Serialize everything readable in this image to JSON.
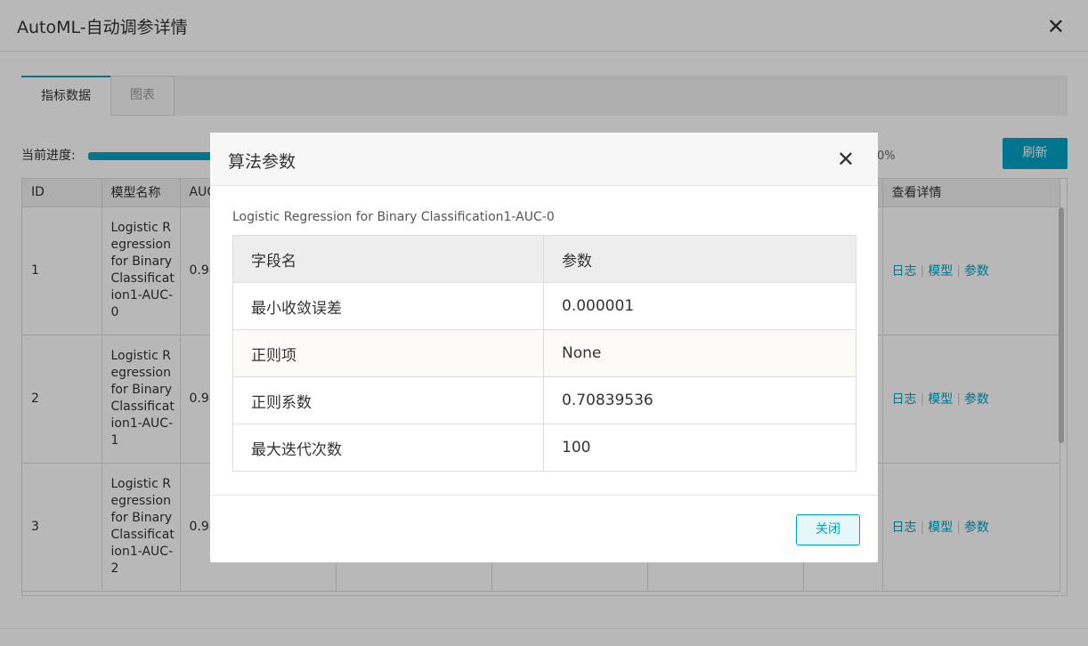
{
  "panel": {
    "title": "AutoML-自动调参详情",
    "close_icon": "✕",
    "tabs": [
      {
        "label": "指标数据",
        "active": true
      },
      {
        "label": "图表",
        "active": false
      }
    ],
    "progress_label": "当前进度:",
    "progress_text": "0%",
    "refresh_label": "刷新",
    "table": {
      "headers": [
        "ID",
        "模型名称",
        "AUC",
        "",
        "",
        "",
        "",
        "查看详情"
      ],
      "rows": [
        {
          "id": "1",
          "name": "Logistic Regression for Binary Classification1-AUC-0",
          "auc": "0.98"
        },
        {
          "id": "2",
          "name": "Logistic Regression for Binary Classification1-AUC-1",
          "auc": "0.98"
        },
        {
          "id": "3",
          "name": "Logistic Regression for Binary Classification1-AUC-2",
          "auc": "0.98"
        }
      ],
      "links": {
        "log": "日志",
        "model": "模型",
        "params": "参数",
        "sep": "|"
      }
    }
  },
  "dialog": {
    "title": "算法参数",
    "close_icon": "✕",
    "subtitle": "Logistic Regression for Binary Classification1-AUC-0",
    "headers": {
      "field": "字段名",
      "value": "参数"
    },
    "rows": [
      {
        "field": "最小收敛误差",
        "value": "0.000001"
      },
      {
        "field": "正则项",
        "value": "None"
      },
      {
        "field": "正则系数",
        "value": "0.70839536"
      },
      {
        "field": "最大迭代次数",
        "value": "100"
      }
    ],
    "close_button": "关闭"
  },
  "colors": {
    "accent": "#00a2c4"
  }
}
